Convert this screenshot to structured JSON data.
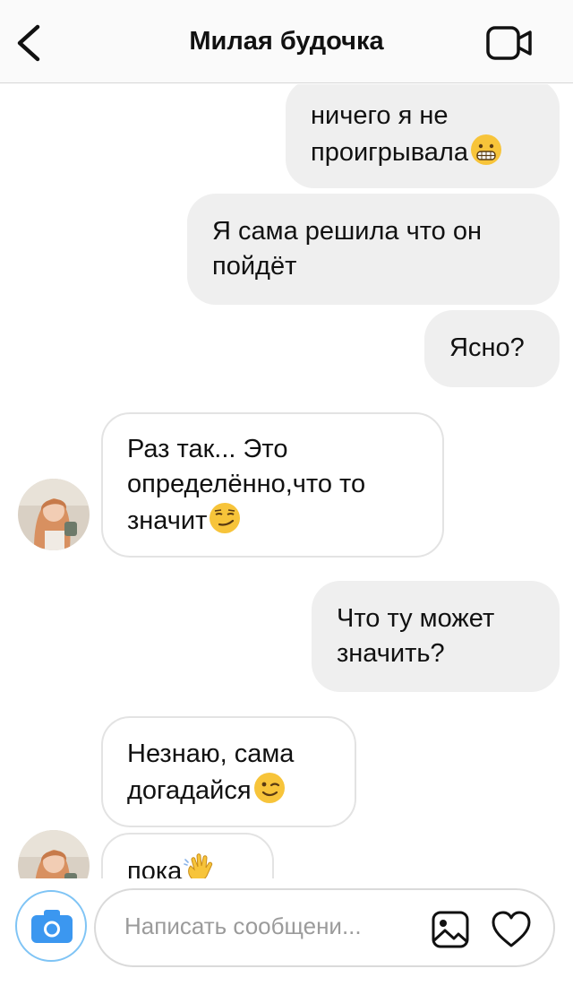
{
  "header": {
    "title": "Милая будочка",
    "back_icon": "chevron-left-icon",
    "video_icon": "video-call-icon"
  },
  "messages": [
    {
      "direction": "outgoing",
      "text": "ничего я не проигрывала",
      "emoji": "grimacing-face"
    },
    {
      "direction": "outgoing",
      "text": "Я сама решила что он пойдёт"
    },
    {
      "direction": "outgoing",
      "text": "Ясно?"
    },
    {
      "direction": "incoming",
      "text": "Раз так... Это определённо,что то значит",
      "emoji": "smirking-face"
    },
    {
      "direction": "outgoing",
      "text": "Что ту может значить?"
    },
    {
      "direction": "incoming",
      "text": "Незнаю, сама догадайся",
      "emoji": "winking-face"
    },
    {
      "direction": "incoming",
      "text": "пока",
      "emoji": "waving-hand"
    }
  ],
  "composer": {
    "placeholder": "Написать сообщени...",
    "camera_icon": "camera-icon",
    "gallery_icon": "gallery-icon",
    "heart_icon": "heart-icon"
  },
  "colors": {
    "outgoing_bubble": "#efefef",
    "incoming_border": "#e3e3e3",
    "camera_ring": "#7fc4f5",
    "camera_fill": "#3b97f0"
  }
}
